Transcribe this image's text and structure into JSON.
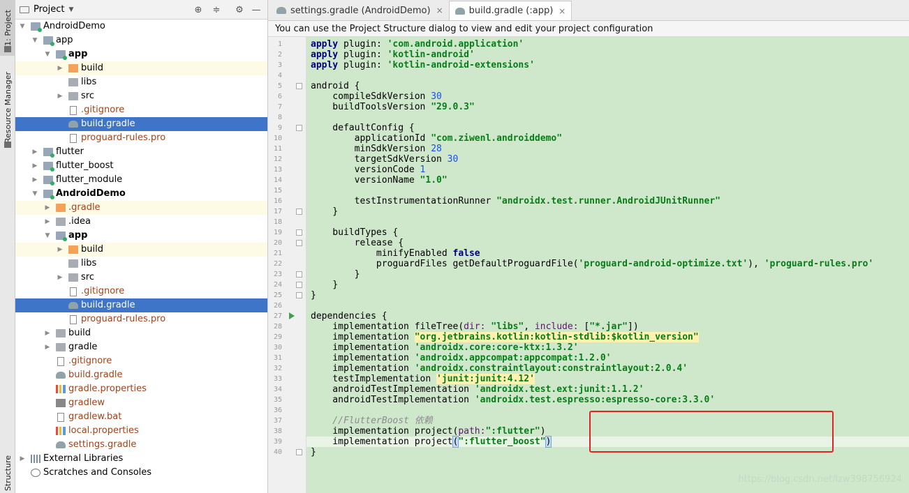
{
  "left_strip": {
    "project_tab": "1: Project",
    "resource_tab": "Resource Manager",
    "structure_tab": "Structure"
  },
  "project_panel": {
    "title": "Project",
    "tree": [
      {
        "label": "AndroidDemo",
        "indent": 0,
        "arrow": "open",
        "icon": "module",
        "style": ""
      },
      {
        "label": "app",
        "indent": 1,
        "arrow": "open",
        "icon": "module",
        "style": ""
      },
      {
        "label": "app",
        "indent": 2,
        "arrow": "open",
        "icon": "module",
        "style": "bold"
      },
      {
        "label": "build",
        "indent": 3,
        "arrow": "closed",
        "icon": "folder-orange",
        "style": "",
        "row": "hl"
      },
      {
        "label": "libs",
        "indent": 3,
        "arrow": "none",
        "icon": "folder",
        "style": ""
      },
      {
        "label": "src",
        "indent": 3,
        "arrow": "closed",
        "icon": "folder",
        "style": ""
      },
      {
        "label": ".gitignore",
        "indent": 3,
        "arrow": "none",
        "icon": "file",
        "style": "brown"
      },
      {
        "label": "build.gradle",
        "indent": 3,
        "arrow": "none",
        "icon": "gradle",
        "style": "",
        "row": "sel"
      },
      {
        "label": "proguard-rules.pro",
        "indent": 3,
        "arrow": "none",
        "icon": "file",
        "style": "brown"
      },
      {
        "label": "flutter",
        "indent": 1,
        "arrow": "closed",
        "icon": "module",
        "style": ""
      },
      {
        "label": "flutter_boost",
        "indent": 1,
        "arrow": "closed",
        "icon": "module",
        "style": ""
      },
      {
        "label": "flutter_module",
        "indent": 1,
        "arrow": "closed",
        "icon": "module",
        "style": ""
      },
      {
        "label": "AndroidDemo",
        "indent": 1,
        "arrow": "open",
        "icon": "module",
        "style": "bold"
      },
      {
        "label": ".gradle",
        "indent": 2,
        "arrow": "closed",
        "icon": "folder-orange",
        "style": "brown",
        "row": "hl"
      },
      {
        "label": ".idea",
        "indent": 2,
        "arrow": "closed",
        "icon": "folder",
        "style": ""
      },
      {
        "label": "app",
        "indent": 2,
        "arrow": "open",
        "icon": "module",
        "style": "bold"
      },
      {
        "label": "build",
        "indent": 3,
        "arrow": "closed",
        "icon": "folder-orange",
        "style": "",
        "row": "hl"
      },
      {
        "label": "libs",
        "indent": 3,
        "arrow": "none",
        "icon": "folder",
        "style": ""
      },
      {
        "label": "src",
        "indent": 3,
        "arrow": "closed",
        "icon": "folder",
        "style": ""
      },
      {
        "label": ".gitignore",
        "indent": 3,
        "arrow": "none",
        "icon": "file",
        "style": "brown"
      },
      {
        "label": "build.gradle",
        "indent": 3,
        "arrow": "none",
        "icon": "gradle",
        "style": "",
        "row": "sel"
      },
      {
        "label": "proguard-rules.pro",
        "indent": 3,
        "arrow": "none",
        "icon": "file",
        "style": "brown"
      },
      {
        "label": "build",
        "indent": 2,
        "arrow": "closed",
        "icon": "folder",
        "style": ""
      },
      {
        "label": "gradle",
        "indent": 2,
        "arrow": "closed",
        "icon": "folder",
        "style": ""
      },
      {
        "label": ".gitignore",
        "indent": 2,
        "arrow": "none",
        "icon": "file",
        "style": "brown"
      },
      {
        "label": "build.gradle",
        "indent": 2,
        "arrow": "none",
        "icon": "gradle",
        "style": "brown"
      },
      {
        "label": "gradle.properties",
        "indent": 2,
        "arrow": "none",
        "icon": "bars",
        "style": "brown"
      },
      {
        "label": "gradlew",
        "indent": 2,
        "arrow": "none",
        "icon": "term",
        "style": "brown"
      },
      {
        "label": "gradlew.bat",
        "indent": 2,
        "arrow": "none",
        "icon": "file",
        "style": "brown"
      },
      {
        "label": "local.properties",
        "indent": 2,
        "arrow": "none",
        "icon": "bars",
        "style": "brown"
      },
      {
        "label": "settings.gradle",
        "indent": 2,
        "arrow": "none",
        "icon": "gradle",
        "style": "brown"
      },
      {
        "label": "External Libraries",
        "indent": 0,
        "arrow": "closed",
        "icon": "lib",
        "style": ""
      },
      {
        "label": "Scratches and Consoles",
        "indent": 0,
        "arrow": "none",
        "icon": "console",
        "style": ""
      }
    ]
  },
  "editor": {
    "tabs": [
      {
        "label": "settings.gradle (AndroidDemo)",
        "active": false
      },
      {
        "label": "build.gradle (:app)",
        "active": true
      }
    ],
    "close_glyph": "×",
    "banner": "You can use the Project Structure dialog to view and edit your project configuration",
    "current_line": 39,
    "lines": [
      [
        [
          "apply ",
          "kw"
        ],
        [
          "plugin",
          ""
        ],
        [
          ": ",
          ""
        ],
        [
          "'com.android.application'",
          "st"
        ]
      ],
      [
        [
          "apply ",
          "kw"
        ],
        [
          "plugin",
          ""
        ],
        [
          ": ",
          ""
        ],
        [
          "'kotlin-android'",
          "st"
        ]
      ],
      [
        [
          "apply ",
          "kw"
        ],
        [
          "plugin",
          ""
        ],
        [
          ": ",
          ""
        ],
        [
          "'kotlin-android-extensions'",
          "st"
        ]
      ],
      [],
      [
        [
          "android {",
          ""
        ]
      ],
      [
        [
          "    compileSdkVersion ",
          ""
        ],
        [
          "30",
          "num"
        ]
      ],
      [
        [
          "    buildToolsVersion ",
          ""
        ],
        [
          "\"29.0.3\"",
          "st"
        ]
      ],
      [],
      [
        [
          "    defaultConfig {",
          ""
        ]
      ],
      [
        [
          "        applicationId ",
          ""
        ],
        [
          "\"com.ziwenl.androiddemo\"",
          "st"
        ]
      ],
      [
        [
          "        minSdkVersion ",
          ""
        ],
        [
          "28",
          "num"
        ]
      ],
      [
        [
          "        targetSdkVersion ",
          ""
        ],
        [
          "30",
          "num"
        ]
      ],
      [
        [
          "        versionCode ",
          ""
        ],
        [
          "1",
          "num"
        ]
      ],
      [
        [
          "        versionName ",
          ""
        ],
        [
          "\"1.0\"",
          "st"
        ]
      ],
      [],
      [
        [
          "        testInstrumentationRunner ",
          ""
        ],
        [
          "\"androidx.test.runner.AndroidJUnitRunner\"",
          "st"
        ]
      ],
      [
        [
          "    }",
          ""
        ]
      ],
      [],
      [
        [
          "    buildTypes {",
          ""
        ]
      ],
      [
        [
          "        release {",
          ""
        ]
      ],
      [
        [
          "            minifyEnabled ",
          ""
        ],
        [
          "false",
          "kw"
        ]
      ],
      [
        [
          "            proguardFiles getDefaultProguardFile(",
          ""
        ],
        [
          "'proguard-android-optimize.txt'",
          "st"
        ],
        [
          "), ",
          ""
        ],
        [
          "'proguard-rules.pro'",
          "st"
        ]
      ],
      [
        [
          "        }",
          ""
        ]
      ],
      [
        [
          "    }",
          ""
        ]
      ],
      [
        [
          "}",
          ""
        ]
      ],
      [],
      [
        [
          "dependencies {",
          ""
        ]
      ],
      [
        [
          "    implementation fileTree(",
          ""
        ],
        [
          "dir: ",
          "pn"
        ],
        [
          "\"libs\"",
          "st"
        ],
        [
          ", ",
          ""
        ],
        [
          "include: ",
          "pn"
        ],
        [
          "[",
          ""
        ],
        [
          "\"*.jar\"",
          "st"
        ],
        [
          "])",
          ""
        ]
      ],
      [
        [
          "    implementation ",
          ""
        ],
        [
          "\"org.jetbrains.kotlin:kotlin-stdlib:$kotlin_version\"",
          "st yhl"
        ]
      ],
      [
        [
          "    implementation ",
          ""
        ],
        [
          "'androidx.core:core-ktx:1.3.2'",
          "st"
        ]
      ],
      [
        [
          "    implementation ",
          ""
        ],
        [
          "'androidx.appcompat:appcompat:1.2.0'",
          "st"
        ]
      ],
      [
        [
          "    implementation ",
          ""
        ],
        [
          "'androidx.constraintlayout:constraintlayout:2.0.4'",
          "st"
        ]
      ],
      [
        [
          "    testImplementation ",
          ""
        ],
        [
          "'junit:junit:4.12'",
          "st yhl"
        ]
      ],
      [
        [
          "    androidTestImplementation ",
          ""
        ],
        [
          "'androidx.test.ext:junit:1.1.2'",
          "st"
        ]
      ],
      [
        [
          "    androidTestImplementation ",
          ""
        ],
        [
          "'androidx.test.espresso:espresso-core:3.3.0'",
          "st"
        ]
      ],
      [],
      [
        [
          "    //FlutterBoost 依赖",
          "cm"
        ]
      ],
      [
        [
          "    implementation project(",
          ""
        ],
        [
          "path:",
          "pn"
        ],
        [
          "\":flutter\"",
          "st"
        ],
        [
          ")",
          ""
        ]
      ],
      [
        [
          "    implementation project",
          ""
        ],
        [
          "(",
          "brk"
        ],
        [
          "\":flutter_boost\"",
          "st"
        ],
        [
          ")",
          "brk"
        ]
      ],
      [
        [
          "}",
          ""
        ]
      ]
    ],
    "fold_lines": [
      5,
      9,
      17,
      19,
      20,
      23,
      24,
      25,
      40
    ],
    "run_lines": [
      27
    ]
  },
  "watermark": "https://blog.csdn.net/lzw398756924"
}
